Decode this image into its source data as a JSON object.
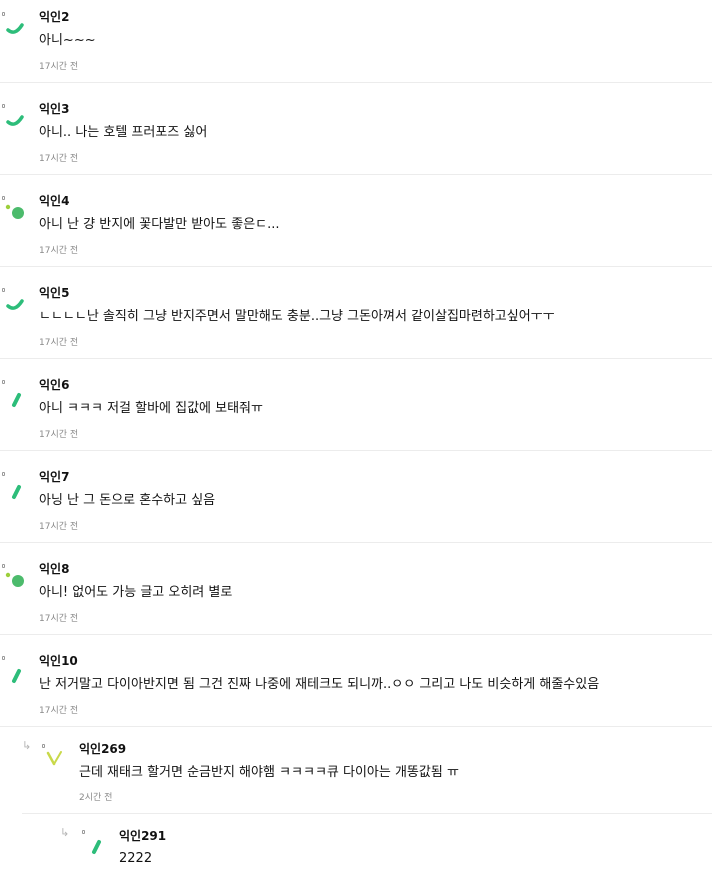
{
  "comments": [
    {
      "name": "익인2",
      "text": "아니~~~",
      "time": "17시간 전"
    },
    {
      "name": "익인3",
      "text": "아니.. 나는 호텔 프러포즈 싫어",
      "time": "17시간 전"
    },
    {
      "name": "익인4",
      "text": "아니 난 걍 반지에 꽃다발만 받아도 좋은ㄷ...",
      "time": "17시간 전"
    },
    {
      "name": "익인5",
      "text": "ㄴㄴㄴㄴ난 솔직히 그냥 반지주면서 말만해도 충분..그냥 그돈아껴서 같이살집마련하고싶어ㅜㅜ",
      "time": "17시간 전"
    },
    {
      "name": "익인6",
      "text": "아니 ㅋㅋㅋ 저걸 할바에 집값에 보태줘ㅠ",
      "time": "17시간 전"
    },
    {
      "name": "익인7",
      "text": "아닝 난 그 돈으로 혼수하고 싶음",
      "time": "17시간 전"
    },
    {
      "name": "익인8",
      "text": "아니! 없어도 가능 글고 오히려 별로",
      "time": "17시간 전"
    },
    {
      "name": "익인10",
      "text": "난 저거말고 다이아반지면 됨 그건 진짜 나중에 재테크도 되니까..ㅇㅇ 그리고 나도 비슷하게 해줄수있음",
      "time": "17시간 전"
    }
  ],
  "replies": [
    {
      "name": "익인269",
      "text": "근데 재태크 할거면 순금반지 해야햄 ㅋㅋㅋㅋ큐 다이아는 개똥값됨 ㅠ",
      "time": "2시간 전"
    },
    {
      "name": "익인291",
      "text": "2222"
    }
  ],
  "reply_arrow": "↳",
  "colors": {
    "green": "#2dbd7a",
    "green_dot": "#4cbb6c",
    "lime": "#c9d94a",
    "lime_dot": "#9ccf3b"
  },
  "icons": [
    "avatar-dot-icon",
    "green-swoosh-icon",
    "green-blob-icon",
    "reply-arrow-icon"
  ]
}
